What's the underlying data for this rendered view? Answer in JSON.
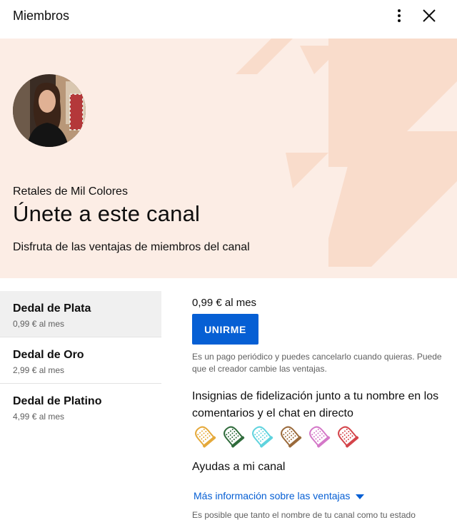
{
  "header": {
    "title": "Miembros",
    "menu_icon": "more-vert-icon",
    "close_icon": "close-icon"
  },
  "hero": {
    "channel_name": "Retales de Mil Colores",
    "headline": "Únete a este canal",
    "subtitle": "Disfruta de las ventajas de miembros del canal",
    "background_color": "#fcede5",
    "decoration_color": "#f9dccb"
  },
  "tiers": [
    {
      "name": "Dedal de Plata",
      "price": "0,99 € al mes",
      "selected": true
    },
    {
      "name": "Dedal de Oro",
      "price": "2,99 € al mes",
      "selected": false
    },
    {
      "name": "Dedal de Platino",
      "price": "4,99 € al mes",
      "selected": false
    }
  ],
  "detail": {
    "price": "0,99 € al mes",
    "join_label": "UNIRME",
    "note": "Es un pago periódico y puedes cancelarlo cuando quieras. Puede que el creador cambie las ventajas.",
    "badges_text": "Insignias de fidelización junto a tu nombre en los comentarios y el chat en directo",
    "badge_colors": [
      "#e5a93a",
      "#2f6b3b",
      "#5fd3de",
      "#9a6a3b",
      "#d478c8",
      "#d4444a"
    ],
    "perk": "Ayudas a mi canal",
    "more_link": "Más información sobre las ventajas",
    "footer_note": "Es posible que tanto el nombre de tu canal como tu estado"
  },
  "colors": {
    "accent": "#065fd4",
    "selected_tier_bg": "#f0f0f0"
  }
}
